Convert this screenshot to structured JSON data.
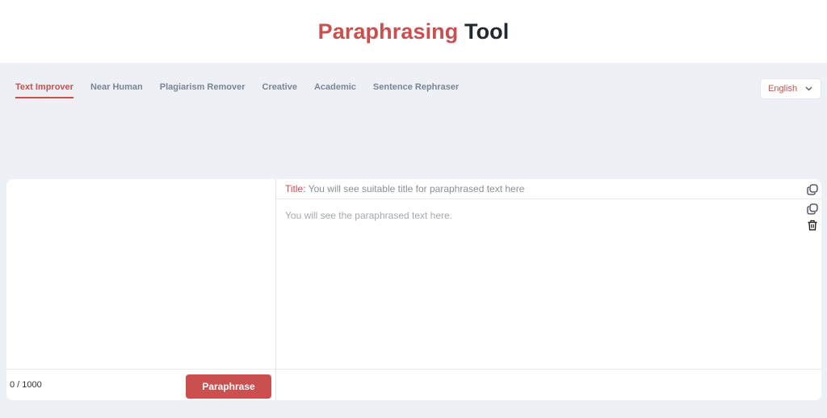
{
  "header": {
    "title_accent": "Paraphrasing",
    "title_rest": "Tool"
  },
  "tabs": [
    {
      "label": "Text Improver",
      "active": true
    },
    {
      "label": "Near Human",
      "active": false
    },
    {
      "label": "Plagiarism Remover",
      "active": false
    },
    {
      "label": "Creative",
      "active": false
    },
    {
      "label": "Academic",
      "active": false
    },
    {
      "label": "Sentence Rephraser",
      "active": false
    }
  ],
  "language": {
    "selected": "English",
    "icon": "chevron-down-icon"
  },
  "input": {
    "value": "",
    "placeholder": "",
    "counter": "0 / 1000",
    "button_label": "Paraphrase"
  },
  "output": {
    "title_label": "Title:",
    "title_placeholder": "You will see suitable title for paraphrased text here",
    "text_placeholder": "You will see the paraphrased text here.",
    "icons": [
      "copy-icon",
      "copy-icon",
      "trash-icon"
    ]
  },
  "colors": {
    "accent": "#c9504f",
    "background": "#edf1f5",
    "tab_inactive": "#7c8596"
  }
}
